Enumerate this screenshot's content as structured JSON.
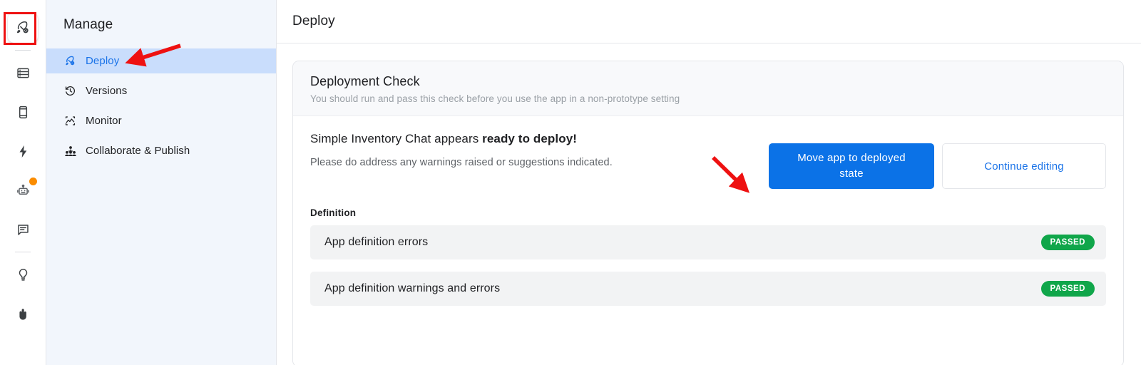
{
  "icon_rail": {
    "items": [
      {
        "name": "rocket-icon",
        "label": "Deploy",
        "active": true,
        "highlighted": true
      },
      {
        "name": "database-icon",
        "label": "Data"
      },
      {
        "name": "mobile-device-icon",
        "label": "Preview"
      },
      {
        "name": "lightning-bolt-icon",
        "label": "Actions"
      },
      {
        "name": "robot-icon",
        "label": "Agent",
        "badge": true
      },
      {
        "name": "chat-bubble-icon",
        "label": "Chat"
      },
      {
        "name": "lightbulb-icon",
        "label": "Tips"
      },
      {
        "name": "hand-pointer-icon",
        "label": "Help"
      }
    ]
  },
  "sidebar": {
    "title": "Manage",
    "items": [
      {
        "label": "Deploy",
        "icon": "rocket-icon",
        "selected": true
      },
      {
        "label": "Versions",
        "icon": "history-clock-icon",
        "selected": false
      },
      {
        "label": "Monitor",
        "icon": "monitor-chart-icon",
        "selected": false
      },
      {
        "label": "Collaborate & Publish",
        "icon": "people-group-icon",
        "selected": false
      }
    ]
  },
  "header": {
    "title": "Deploy"
  },
  "check_card": {
    "title": "Deployment Check",
    "subtitle": "You should run and pass this check before you use the app in a non-prototype setting",
    "ready_prefix": "Simple Inventory Chat appears ",
    "ready_bold": "ready to deploy!",
    "address_note": "Please do address any warnings raised or suggestions indicated.",
    "primary_button": "Move app to deployed state",
    "secondary_button": "Continue editing",
    "section_label": "Definition",
    "rows": [
      {
        "label": "App definition errors",
        "status": "PASSED"
      },
      {
        "label": "App definition warnings and errors",
        "status": "PASSED"
      }
    ]
  },
  "annotations": {
    "arrow_color": "#ee1111",
    "highlight_color": "#ee1111",
    "arrow_sidebar_name": "arrow-pointing-to-deploy-nav",
    "arrow_button_name": "arrow-pointing-to-move-app-button"
  },
  "colors": {
    "accent": "#1a73e8",
    "primary_button": "#0b72e7",
    "badge_pass": "#10a64a",
    "sidebar_bg": "#f2f6fc",
    "selected_nav_bg": "#c9ddfc"
  }
}
